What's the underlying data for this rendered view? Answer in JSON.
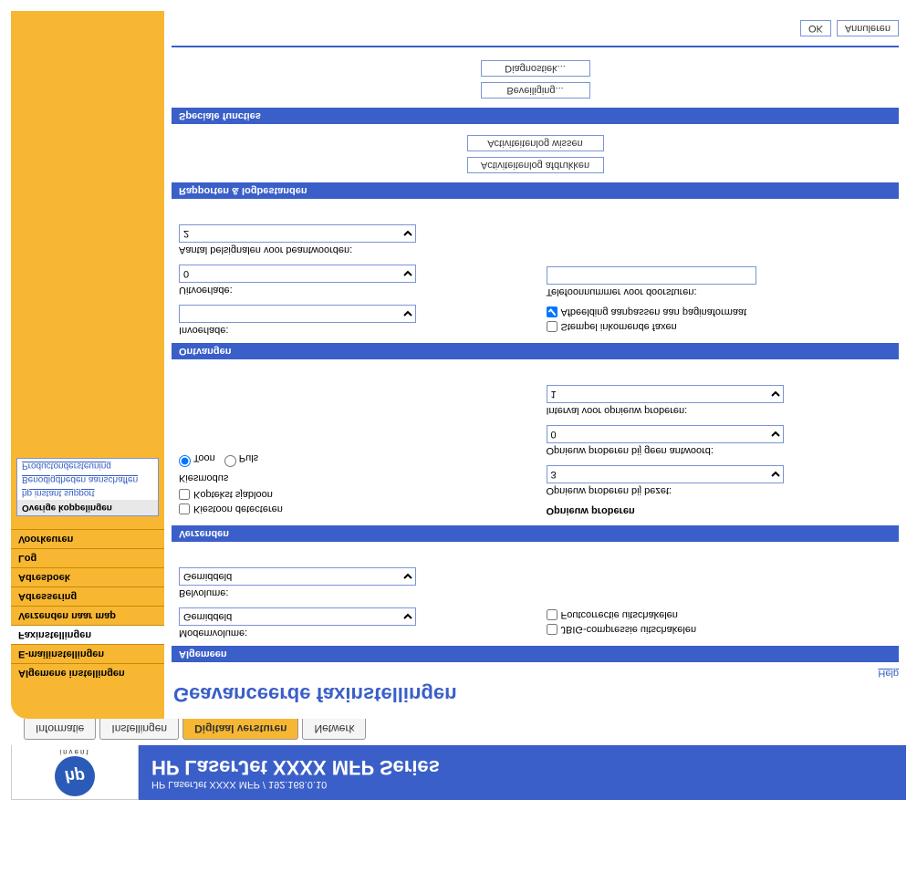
{
  "header": {
    "subtitle": "HP LaserJet XXXX MFP / 192.168.0.10",
    "title": "HP LaserJet XXXX MFP Series",
    "logo_text": "hp",
    "logo_sub": "invent"
  },
  "tabs": {
    "t0": "Informatie",
    "t1": "Instellingen",
    "t2": "Digitaal versturen",
    "t3": "Netwerk"
  },
  "sidebar": {
    "items": {
      "alg": "Algemene instellingen",
      "email": "E-mailinstellingen",
      "fax": "Faxinstellingen",
      "map": "Verzenden naar map",
      "adr": "Adressering",
      "book": "Adresboek",
      "log": "Log",
      "pref": "Voorkeuren"
    },
    "links_hdr": "Overige koppelingen",
    "links": {
      "l0": "hp instant support",
      "l1": "Benodigdheden aanschaffen",
      "l2": "Productondersteuning"
    }
  },
  "main": {
    "title": "Geavanceerde faxinstellingen",
    "help": "Help",
    "sections": {
      "algemeen": "Algemeen",
      "verzenden": "Verzenden",
      "ontvangen": "Ontvangen",
      "rapporten": "Rapporten & logbestanden",
      "speciaal": "Speciale functies"
    },
    "algemeen": {
      "modem_lbl": "Modemvolume:",
      "modem_val": "Gemiddeld",
      "bel_lbl": "Belvolume:",
      "bel_val": "Gemiddeld",
      "jbig": "JBIG-compressie uitschakelen",
      "fout": "Foutcorrectie uitschakelen"
    },
    "verzenden": {
      "kiestoon": "Kiestoon detecteren",
      "koptekst": "Koptekst sjabloon",
      "kiesmodus": "Kiesmodus",
      "toon": "Toon",
      "puls": "Puls",
      "retry_hdr": "Opnieuw proberen",
      "bezet_lbl": "Opnieuw proberen bij bezet:",
      "bezet_val": "3",
      "geen_lbl": "Opnieuw proberen bij geen antwoord:",
      "geen_val": "0",
      "interval_lbl": "Interval voor opnieuw proberen:",
      "interval_val": "1"
    },
    "ontvangen": {
      "invoer_lbl": "Invoerlade:",
      "invoer_val": "",
      "uitvoer_lbl": "Uitvoerlade:",
      "uitvoer_val": "0",
      "aantal_lbl": "Aantal belsignalen voor beantwoorden:",
      "aantal_val": "2",
      "stempel": "Stempel inkomende faxen",
      "aanpassen": "Afbeelding aanpassen aan paginaformaat",
      "tel_lbl": "Telefoonnummer voor doorsturen:",
      "tel_val": ""
    },
    "rapporten": {
      "afdrukken": "Activiteitenlog afdrukken",
      "wissen": "Activiteitenlog wissen"
    },
    "speciaal": {
      "beveiliging": "Beveiliging...",
      "diagnostiek": "Diagnostiek..."
    },
    "footer": {
      "ok": "OK",
      "cancel": "Annuleren"
    }
  }
}
